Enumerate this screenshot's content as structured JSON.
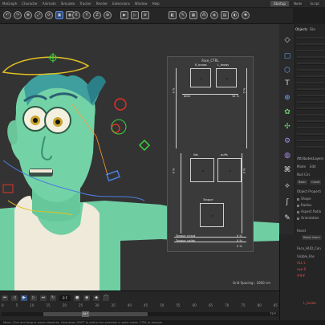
{
  "menu": {
    "items": [
      "MoGraph",
      "Character",
      "Animate",
      "Simulate",
      "Tracker",
      "Render",
      "Extensions",
      "Window",
      "Help"
    ],
    "layouts": [
      "Startup",
      "Node",
      "Script"
    ]
  },
  "toolbar": {
    "icons": [
      "undo-icon",
      "redo-icon",
      "move-icon",
      "scale-icon",
      "rotate-icon",
      "select-icon",
      "live-select-icon",
      "axis-x-icon",
      "axis-y-icon",
      "axis-z-icon",
      "coord-icon",
      "render-view-icon",
      "render-icon",
      "render-settings-icon",
      "cube-icon",
      "pen-icon",
      "subdivide-icon",
      "cloner-icon",
      "deformer-icon",
      "scene-icon",
      "camera-icon",
      "light-icon"
    ]
  },
  "objects_panel": {
    "tabs": [
      "Objects",
      "File"
    ]
  },
  "attributes": {
    "tabs": [
      "Attributes",
      "Layers"
    ],
    "mode_label": "Mode",
    "edit_label": "Edit",
    "object_name": "Null Circ",
    "basic_label": "Basic",
    "coord_label": "Coord",
    "section_title": "Object Properti",
    "props": [
      "Shape",
      "Radius",
      "Aspect Ratio",
      "Orientation"
    ],
    "reset_label": "Reset",
    "reset_button": "Reset Users",
    "list_header": "Face_HUD_Con",
    "list_items": [
      "Visible_Pos",
      "ALL L",
      "eye R",
      "###"
    ],
    "bottom_item": "L_brows"
  },
  "face_ui": {
    "title": "Face_CTRL",
    "brow_r": "R_brows",
    "brow_l": "L_brows",
    "blink": "blink",
    "blink_pct": "34 %",
    "lids_l": "lids",
    "lids_r": "puffs",
    "mouth": "Tongue",
    "pct_top_left": "0 %",
    "pct_top_right": "0 %",
    "pct_bottom_left": "0 %",
    "pct_bottom_right": "0 %",
    "tongue_inout": "Tongue_in/out",
    "tongue_updn": "Tongue_up/dn",
    "val_0": "0 %",
    "val_1": "0 %",
    "val_2": "0 %"
  },
  "viewport": {
    "grid_spacing": "Grid Spacing : 1000 cm"
  },
  "timeline": {
    "frame_field": "0 F",
    "ruler": [
      "0",
      "5",
      "10",
      "15",
      "20",
      "25",
      "30",
      "35",
      "40",
      "45",
      "50",
      "55",
      "60",
      "65",
      "70",
      "75",
      "80",
      "85"
    ],
    "scrub_label": "44 F",
    "end_field": "72 F"
  },
  "status": {
    "text": "Move: Click and drag to move elements. Hold down SHIFT to add to the selection in point mode, CTRL to remove."
  },
  "colors": {
    "accent": "#5a8fe0",
    "viewport_bg": "#333333",
    "skin": "#74d3a6",
    "rig_red": "#e0302a",
    "rig_yellow": "#e2c020",
    "rig_blue": "#4a7fe0",
    "rig_green": "#3ed23e",
    "shirt": "#efeada"
  }
}
